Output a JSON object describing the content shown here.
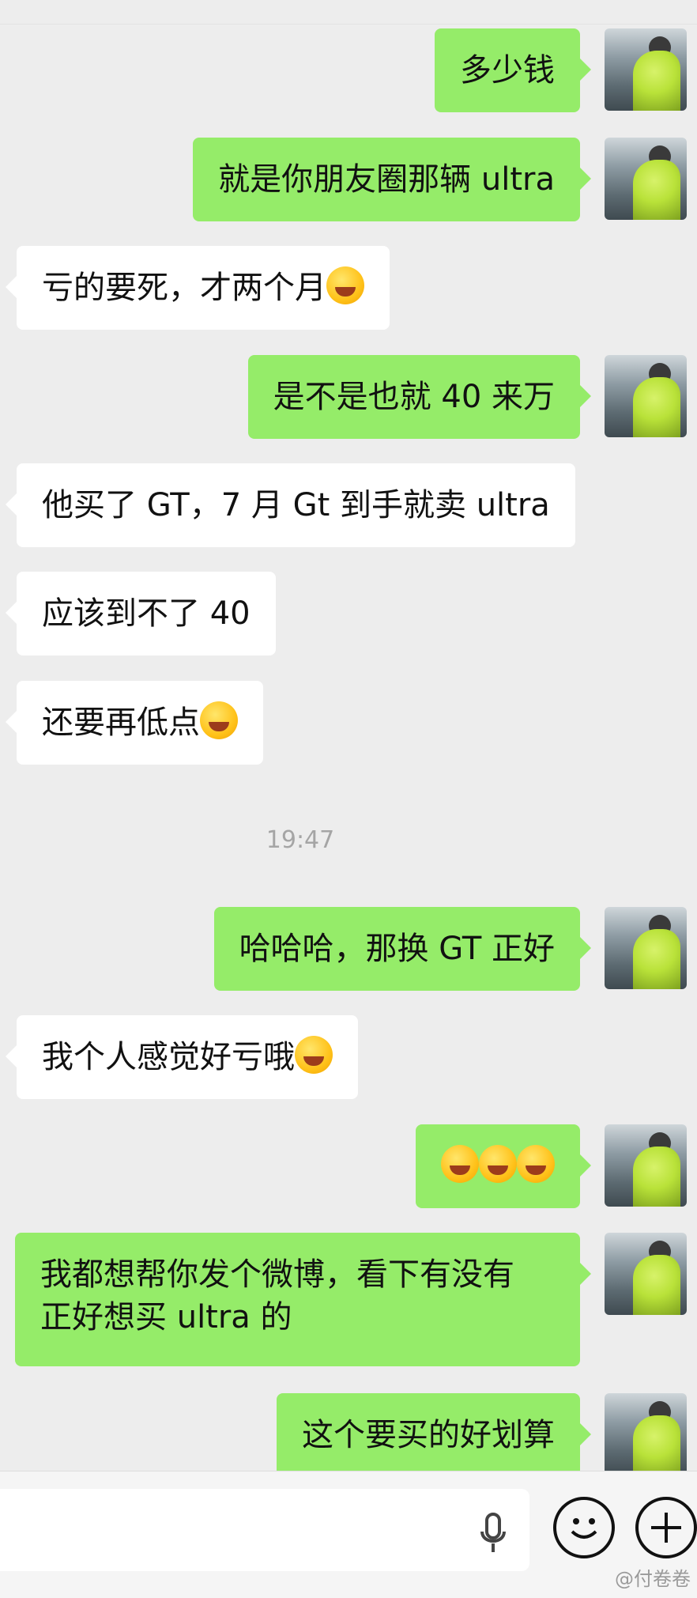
{
  "chat": {
    "timestamp": "19:47",
    "messages": [
      {
        "side": "out",
        "text": "多少钱"
      },
      {
        "side": "out",
        "text": "就是你朋友圈那辆 ultra"
      },
      {
        "side": "in",
        "text": "亏的要死，才两个月",
        "emoji": "face-laughing-crying"
      },
      {
        "side": "out",
        "text": "是不是也就 40 来万"
      },
      {
        "side": "in",
        "text": "他买了 GT，7 月 Gt 到手就卖 ultra"
      },
      {
        "side": "in",
        "text": "应该到不了 40"
      },
      {
        "side": "in",
        "text": "还要再低点",
        "emoji": "face-laughing-crying"
      },
      {
        "side": "out",
        "text": "哈哈哈，那换 GT 正好"
      },
      {
        "side": "in",
        "text": "我个人感觉好亏哦",
        "emoji": "face-laughing-crying"
      },
      {
        "side": "out",
        "text": "",
        "emoji": "face-laughing-crying"
      },
      {
        "side": "out",
        "text_line1": "我都想帮你发个微博，看下有没有",
        "text_line2": "正好想买 ultra 的"
      },
      {
        "side": "out",
        "text": "这个要买的好划算"
      }
    ]
  },
  "bottom_bar": {
    "voice_icon": "mic-icon",
    "emoji_icon": "smile-icon",
    "plus_icon": "plus-icon"
  },
  "watermark": "@付卷卷"
}
